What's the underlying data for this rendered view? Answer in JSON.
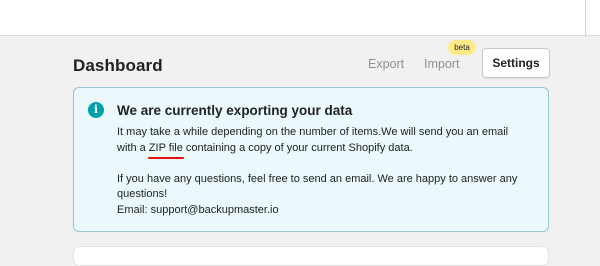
{
  "header": {
    "title": "Dashboard",
    "actions": {
      "export_label": "Export",
      "import_label": "Import",
      "import_badge": "beta",
      "settings_label": "Settings"
    }
  },
  "banner": {
    "icon": "info-icon",
    "icon_glyph": "i",
    "title": "We are currently exporting your data",
    "line1": "It may take a while depending on the number of items.We will send you an email",
    "line2_pre": "with a ",
    "line2_highlight": "ZIP file",
    "line2_post": " containing a copy of your current Shopify data.",
    "line3": "If you have any questions, feel free to send an email. We are happy to answer any",
    "line4": "questions!",
    "line5": "Email: support@backupmaster.io"
  },
  "colors": {
    "page_bg": "#f1f1f2",
    "banner_bg": "#ebf9fc",
    "banner_border": "#98c6cd",
    "info_icon": "#00a0ac",
    "beta_badge": "#ffea8a",
    "highlight_underline": "#e3120b"
  }
}
